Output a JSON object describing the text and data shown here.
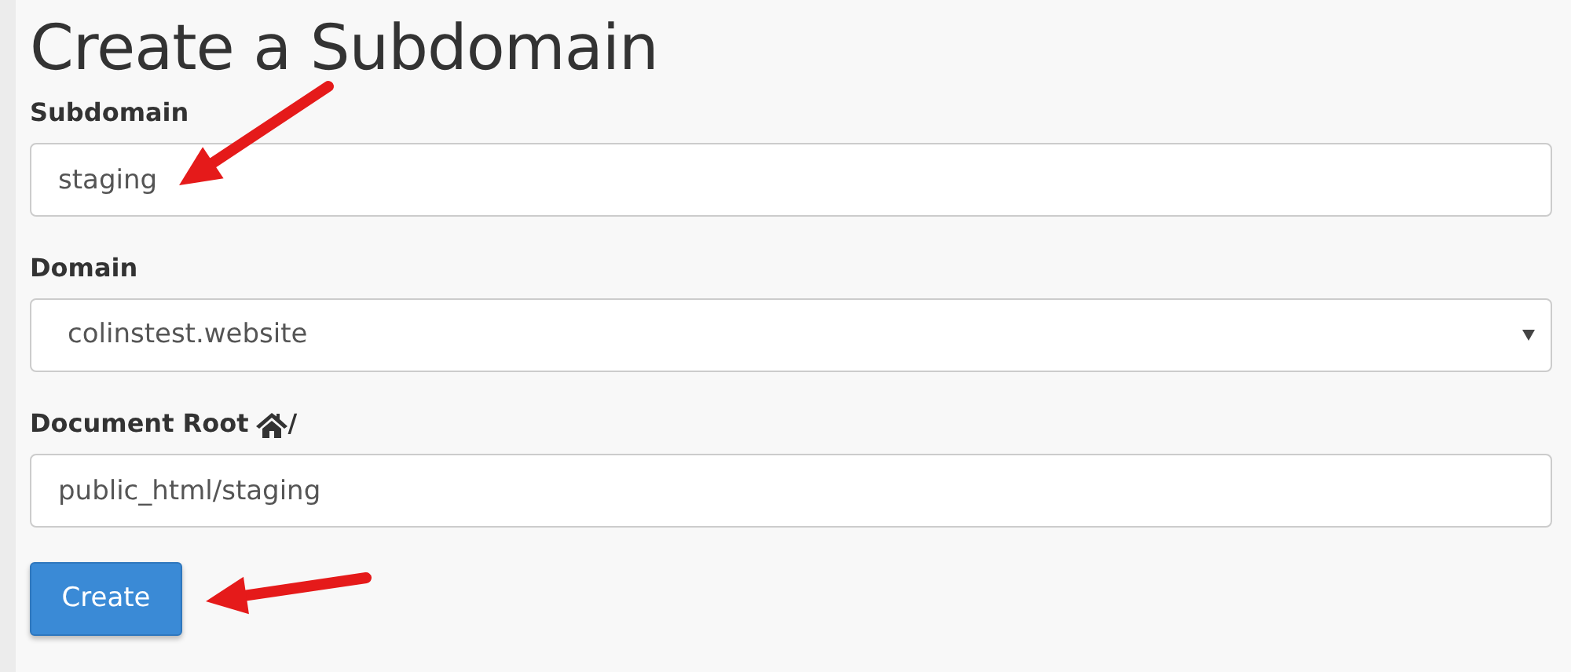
{
  "title": "Create a Subdomain",
  "fields": [
    {
      "kind": "text",
      "label": "Subdomain",
      "value": "staging",
      "annotated": true
    },
    {
      "kind": "select",
      "label": "Domain",
      "value": "colinstest.website",
      "annotated": false
    },
    {
      "kind": "text",
      "label": "Document Root",
      "label_suffix": "/",
      "home_icon": true,
      "value": "public_html/staging",
      "annotated": false
    }
  ],
  "submit": {
    "label": "Create",
    "annotated": true
  }
}
